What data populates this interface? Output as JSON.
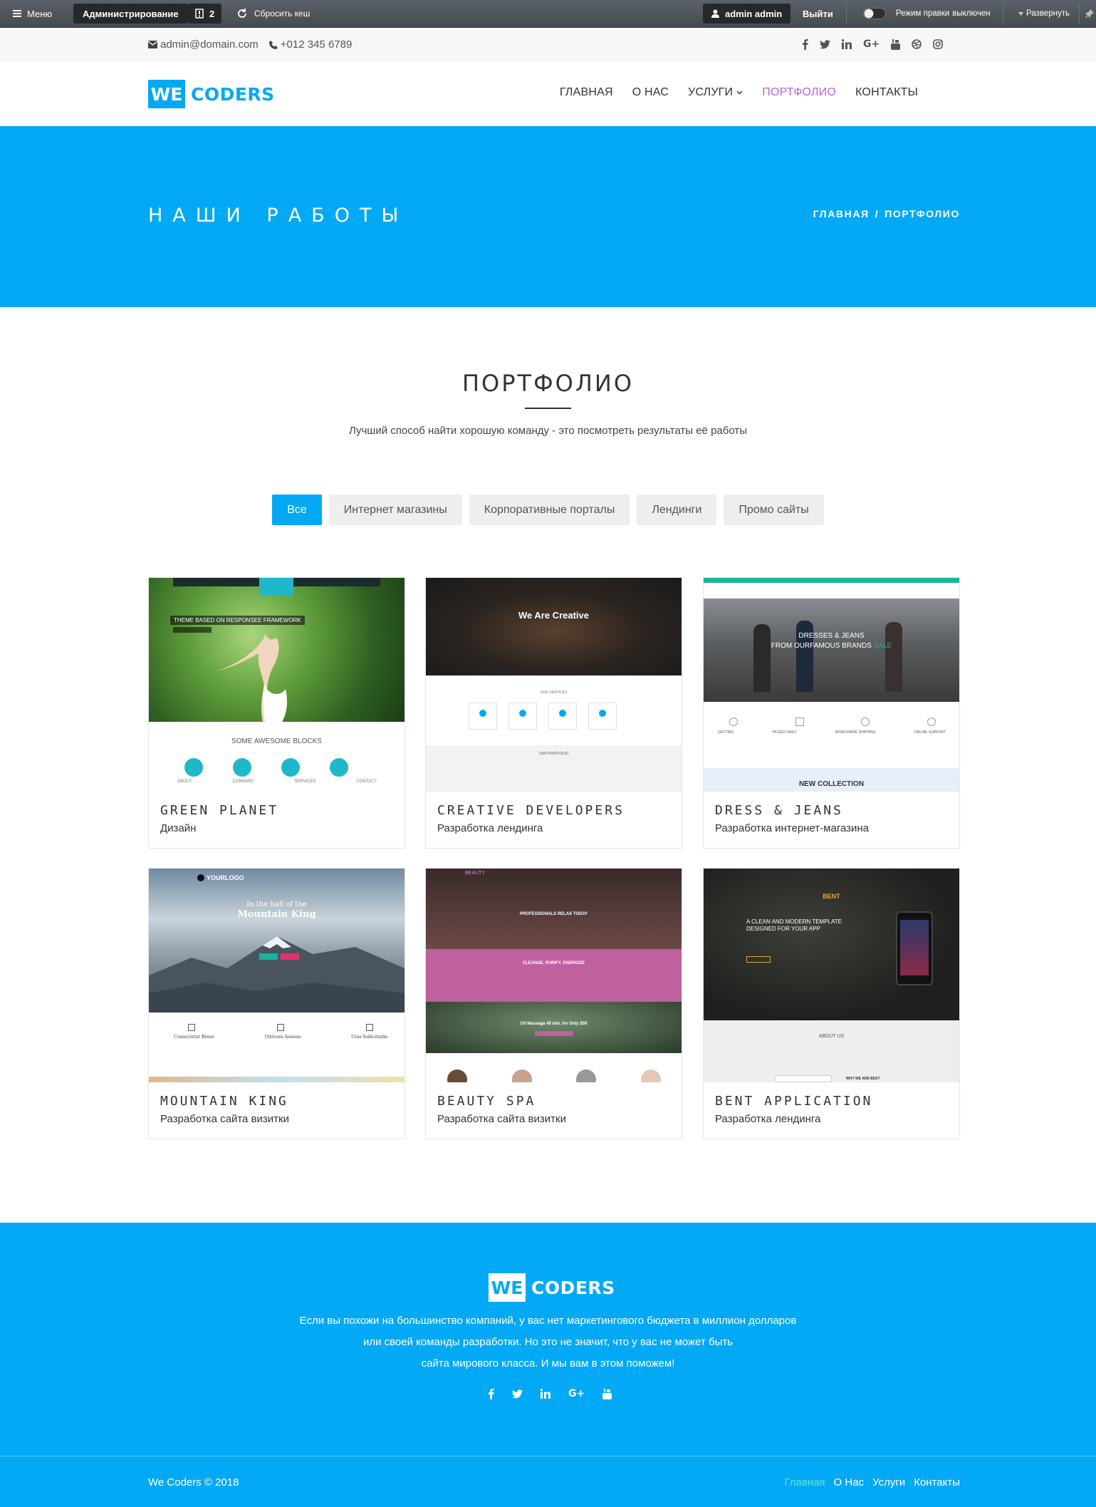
{
  "adminbar": {
    "menu_label": "Меню",
    "admin_label": "Администрирование",
    "count": "2",
    "cache_label": "Сбросить кеш",
    "user_label": "admin admin",
    "logout_label": "Выйти",
    "edit_mode_label": "Режим правки",
    "edit_mode_state": "выключен",
    "expand_label": "Развернуть"
  },
  "topline": {
    "email": "admin@domain.com",
    "phone": "+012 345 6789",
    "social_icons": [
      "facebook-icon",
      "twitter-icon",
      "linkedin-icon",
      "google-plus-icon",
      "youtube-icon",
      "dribbble-icon",
      "instagram-icon"
    ]
  },
  "logo": {
    "box": "WE",
    "text": "CODERS"
  },
  "nav": [
    {
      "label": "ГЛАВНАЯ"
    },
    {
      "label": "О НАС"
    },
    {
      "label": "УСЛУГИ"
    },
    {
      "label": "ПОРТФОЛИО",
      "active": true
    },
    {
      "label": "КОНТАКТЫ"
    }
  ],
  "hero": {
    "title": "НАШИ РАБОТЫ",
    "breadcrumb_home": "ГЛАВНАЯ",
    "breadcrumb_sep": "/",
    "breadcrumb_current": "ПОРТФОЛИО"
  },
  "section": {
    "title": "ПОРТФОЛИО",
    "subtitle": "Лучший способ найти хорошую команду - это посмотреть результаты её работы"
  },
  "filters": [
    "Все",
    "Интернет магазины",
    "Корпоративные порталы",
    "Лендинги",
    "Промо сайты"
  ],
  "portfolio": [
    {
      "title": "GREEN PLANET",
      "category": "Дизайн",
      "thumb": {
        "t1": "THEME BASED ON RESPONSEE FRAMEWORK",
        "t2": "SOME AWESOME BLOCKS",
        "labels": [
          "ABOUT",
          "COMPANY",
          "SERVICES",
          "CONTACT"
        ]
      }
    },
    {
      "title": "CREATIVE DEVELOPERS",
      "category": "Разработка лендинга",
      "thumb": {
        "t1": "We Are Creative",
        "t2": "OUR SERVICES",
        "t3": "OUR PORTFOLIO"
      }
    },
    {
      "title": "DRESS & JEANS",
      "category": "Разработка интернет-магазина",
      "thumb": {
        "t1": "DRESSES & JEANS",
        "t2": "FROM OURFAMOUS BRANDS",
        "t3": "SALE",
        "t4": "NEW COLLECTION",
        "labels": [
          "GETTING",
          "PICKED DAILY",
          "WORLDWIDE SHIPPING",
          "ONLINE SUPPORT"
        ]
      }
    },
    {
      "title": "MOUNTAIN KING",
      "category": "Разработка сайта визитки",
      "thumb": {
        "t1": "In the hall of the",
        "t2": "Mountain King",
        "logo": "YOURLOGO",
        "labels": [
          "Consectetur Besse",
          "Ultricies Aenean",
          "Cras Sollicitudin"
        ]
      }
    },
    {
      "title": "BEAUTY SPA",
      "category": "Разработка сайта визитки",
      "thumb": {
        "t1": "PROFESSIONALS RELAX TODAY",
        "t2": "CLEANSE. PURIFY. ENERGIZE",
        "t3": "Oil Massage 45 min. for Only $59",
        "t4": "BEAUTY"
      }
    },
    {
      "title": "BENT APPLICATION",
      "category": "Разработка лендинга",
      "thumb": {
        "t1": "A CLEAN AND MODERN TEMPLATE DESIGNED FOR YOUR APP",
        "t2": "ABOUT US",
        "t3": "WHY WE ARE BEST",
        "logo": "BENT"
      }
    }
  ],
  "footer": {
    "logo_box": "WE",
    "logo_text": "CODERS",
    "desc_line1": "Если вы похожи на большинство компаний, у вас нет маркетингового бюджета в миллион долларов",
    "desc_line2": "или своей команды разработки. Но это не значит, что у вас не может быть",
    "desc_line3": "сайта мирового класса. И мы вам в этом поможем!",
    "social_icons": [
      "facebook-icon",
      "twitter-icon",
      "linkedin-icon",
      "google-plus-icon",
      "youtube-icon"
    ],
    "copyright": "We Coders © 2018",
    "links": [
      {
        "label": "Главная",
        "active": true
      },
      {
        "label": "О Нас"
      },
      {
        "label": "Услуги"
      },
      {
        "label": "Контакты"
      }
    ]
  },
  "colors": {
    "accent": "#03a9f4",
    "nav_active": "#b565d8",
    "footer_link_active": "#5ee5d8"
  }
}
